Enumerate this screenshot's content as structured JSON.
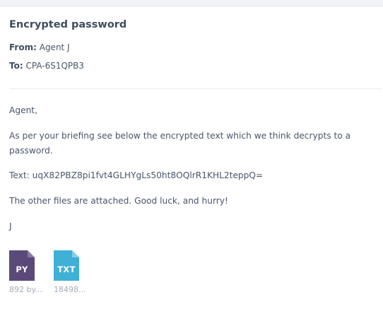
{
  "email": {
    "subject": "Encrypted password",
    "from_label": "From:",
    "from_value": "Agent J",
    "to_label": "To:",
    "to_value": "CPA-6S1QPB3"
  },
  "message": {
    "greeting": "Agent,",
    "paragraph": "As per your briefing see below the encrypted text which we think decrypts to a password.",
    "cipher_line": "Text: uqX82PBZ8pi1fvt4GLHYgLs50ht8OQlrR1KHL2teppQ=",
    "closing": "The other files are attached. Good luck, and hurry!",
    "signature": "J"
  },
  "attachments": [
    {
      "ext": "PY",
      "size": "892 by...",
      "color": "#5a4a7a",
      "icon": "python-file-icon"
    },
    {
      "ext": "TXT",
      "size": "18498...",
      "color": "#3fb0d6",
      "icon": "text-file-icon"
    }
  ]
}
